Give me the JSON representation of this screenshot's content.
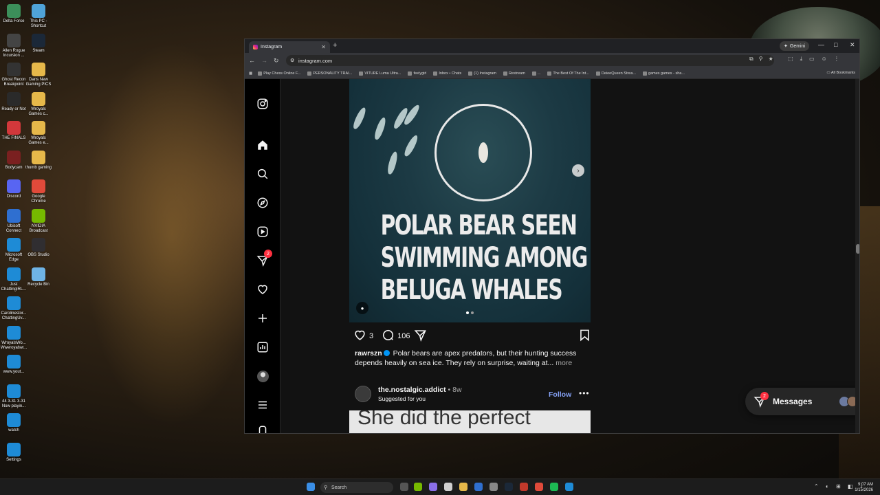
{
  "desktop": {
    "icons_left": [
      {
        "label": "Delta Force",
        "color": "#3c8f5a"
      },
      {
        "label": "Allen Rogue Incursion ...",
        "color": "#444"
      },
      {
        "label": "Ghost Recon Breakpoint",
        "color": "#333"
      },
      {
        "label": "Ready or Not",
        "color": "#2a2a2a"
      },
      {
        "label": "THE FINALS",
        "color": "#d2383b"
      },
      {
        "label": "Bodycam",
        "color": "#7a2020"
      },
      {
        "label": "Discord",
        "color": "#5865f2"
      },
      {
        "label": "Ubisoft Connect",
        "color": "#2f6fd0"
      },
      {
        "label": "Microsoft Edge",
        "color": "#1e8bd6"
      },
      {
        "label": "Just ChattingIRL...",
        "color": "#1e8bd6"
      },
      {
        "label": "Carolinestor... ChattingUv...",
        "color": "#1e8bd6"
      },
      {
        "label": "WroyalsWo... Wweroyalsw...",
        "color": "#1e8bd6"
      },
      {
        "label": "www.yout...",
        "color": "#1e8bd6"
      },
      {
        "label": "44 3-31 3-31 Now playin...",
        "color": "#1e8bd6"
      },
      {
        "label": "watch",
        "color": "#1e8bd6"
      },
      {
        "label": "Settings",
        "color": "#1e8bd6"
      }
    ],
    "icons_right": [
      {
        "label": "This PC - Shortcut",
        "color": "#4fa3d8"
      },
      {
        "label": "Steam",
        "color": "#1b2838"
      },
      {
        "label": "Dans New Gaming PICS",
        "color": "#e6b84a"
      },
      {
        "label": "Wroyals Games c...",
        "color": "#e6b84a"
      },
      {
        "label": "Wroyals Games e...",
        "color": "#e6b84a"
      },
      {
        "label": "thumb gaming",
        "color": "#e6b84a"
      },
      {
        "label": "Google Chrome",
        "color": "#e04a3a"
      },
      {
        "label": "NVIDIA Broadcast",
        "color": "#76b900"
      },
      {
        "label": "OBS Studio",
        "color": "#302e31"
      },
      {
        "label": "Recycle Bin",
        "color": "#6fb4e6"
      }
    ]
  },
  "browser": {
    "tab_title": "Instagram",
    "gemini_label": "Gemini",
    "url": "instagram.com",
    "bookmarks": [
      "Play Chess Online F...",
      "PERSONALITY TRAI...",
      "VITURE Luma Ultra...",
      "feelygirl",
      "Inbox • Chats",
      "(1) Instagram",
      "Restream",
      "...",
      "The Best Of The Int...",
      "DeieeQueen Strea...",
      "games games - sha..."
    ],
    "all_bookmarks": "All Bookmarks"
  },
  "post": {
    "headline_lines": [
      "POLAR BEAR SEEN",
      "SWIMMING AMONG",
      "BELUGA WHALES"
    ],
    "likes": "3",
    "comments": "106",
    "username": "rawrszn",
    "caption": "Polar bears are apex predators, but their hunting success depends heavily on sea ice. They rely on surprise, waiting at...",
    "more_label": "more"
  },
  "post2": {
    "username": "the.nostalgic.addict",
    "time": "8w",
    "subtitle": "Suggested for you",
    "follow_label": "Follow",
    "image_text": "She did the perfect"
  },
  "sidebar": {
    "notifications_badge": "2"
  },
  "messages": {
    "label": "Messages",
    "badge": "2"
  },
  "taskbar": {
    "search_placeholder": "Search",
    "time": "9:07 AM",
    "date": "1/15/2026"
  }
}
